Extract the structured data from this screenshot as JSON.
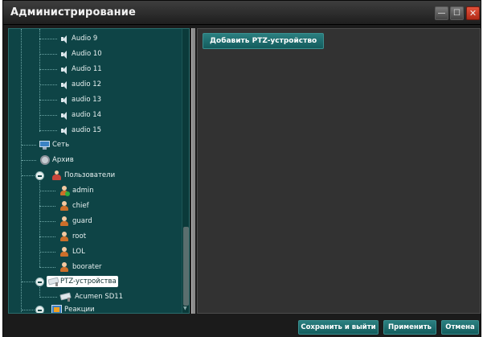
{
  "window": {
    "title": "Администрирование",
    "controls": {
      "minimize": "—",
      "maximize": "☐",
      "close": "✕"
    }
  },
  "tree": {
    "audio_items": [
      "Audio 9",
      "Audio 10",
      "Audio 11",
      "audio 12",
      "audio 13",
      "audio 14",
      "audio 15"
    ],
    "network": "Сеть",
    "archive": "Архив",
    "users_group": "Пользователи",
    "users": [
      "admin",
      "chief",
      "guard",
      "root",
      "LOL",
      "boorater"
    ],
    "ptz_group": "PTZ-устройства",
    "ptz_child": "Acumen SD11",
    "reactions": "Реакции"
  },
  "content": {
    "add_ptz_button": "Добавить PTZ-устройство"
  },
  "footer": {
    "save_exit": "Сохранить и выйти",
    "apply": "Применить",
    "cancel": "Отмена"
  },
  "colors": {
    "tree_bg": "#0e4446",
    "button_teal": "#1f6f70",
    "window_bg": "#1b1b1b",
    "content_bg": "#323232",
    "close_red": "#c43a24"
  }
}
